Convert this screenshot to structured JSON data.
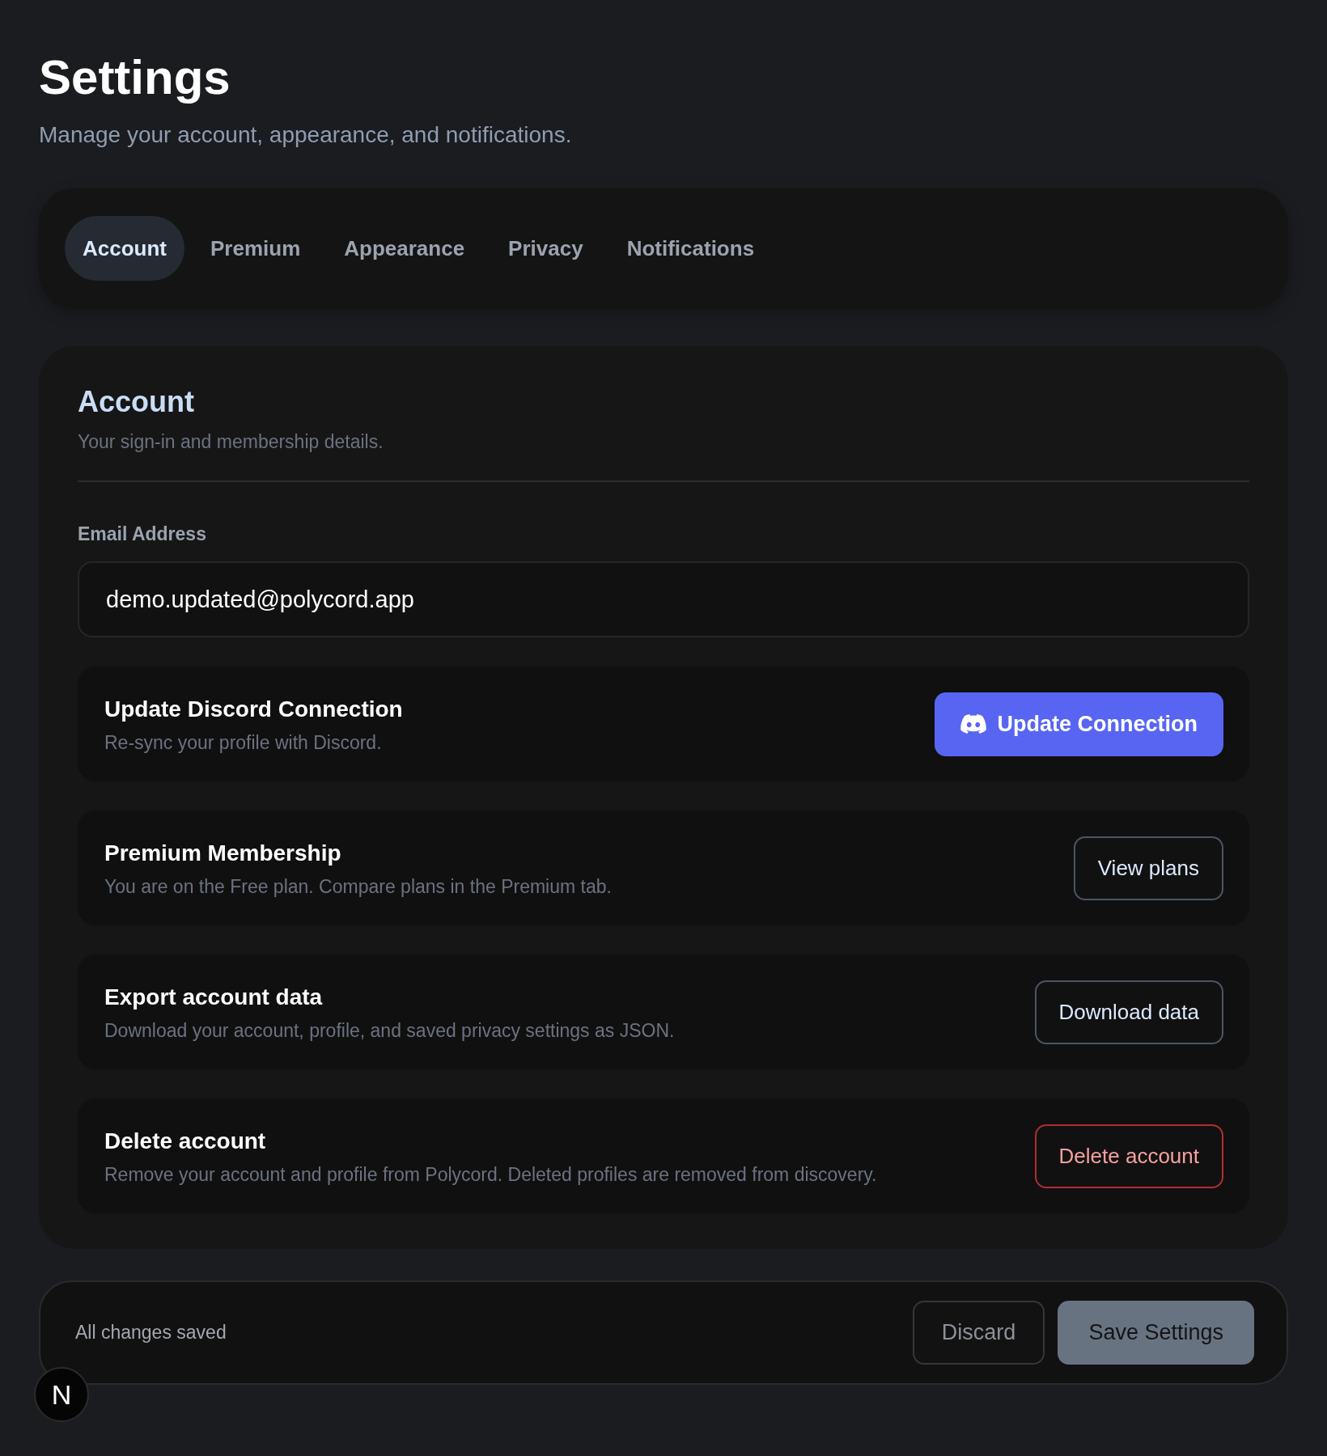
{
  "header": {
    "title": "Settings",
    "subtitle": "Manage your account, appearance, and notifications."
  },
  "tabs": [
    {
      "label": "Account",
      "selected": true
    },
    {
      "label": "Premium",
      "selected": false
    },
    {
      "label": "Appearance",
      "selected": false
    },
    {
      "label": "Privacy",
      "selected": false
    },
    {
      "label": "Notifications",
      "selected": false
    }
  ],
  "section": {
    "title": "Account",
    "subtitle": "Your sign-in and membership details.",
    "email_field": {
      "label": "Email Address",
      "value": "demo.updated@polycord.app"
    },
    "rows": [
      {
        "title": "Update Discord Connection",
        "description": "Re-sync your profile with Discord.",
        "action": {
          "label": "Update Connection",
          "kind": "brand"
        }
      },
      {
        "title": "Premium Membership",
        "description": "You are on the Free plan. Compare plans in the Premium tab.",
        "action": {
          "label": "View plans",
          "kind": "outline"
        }
      },
      {
        "title": "Export account data",
        "description": "Download your account, profile, and saved privacy settings as JSON.",
        "action": {
          "label": "Download data",
          "kind": "outline"
        }
      },
      {
        "title": "Delete account",
        "description": "Remove your account and profile from Polycord. Deleted profiles are removed from discovery.",
        "action": {
          "label": "Delete account",
          "kind": "danger"
        }
      }
    ]
  },
  "footer": {
    "status": "All changes saved",
    "buttons": [
      {
        "label": "Discard",
        "kind": "secondary",
        "disabled": true
      },
      {
        "label": "Save Settings",
        "kind": "primary",
        "disabled": true
      }
    ]
  },
  "dev_badge": {
    "label": "N"
  }
}
